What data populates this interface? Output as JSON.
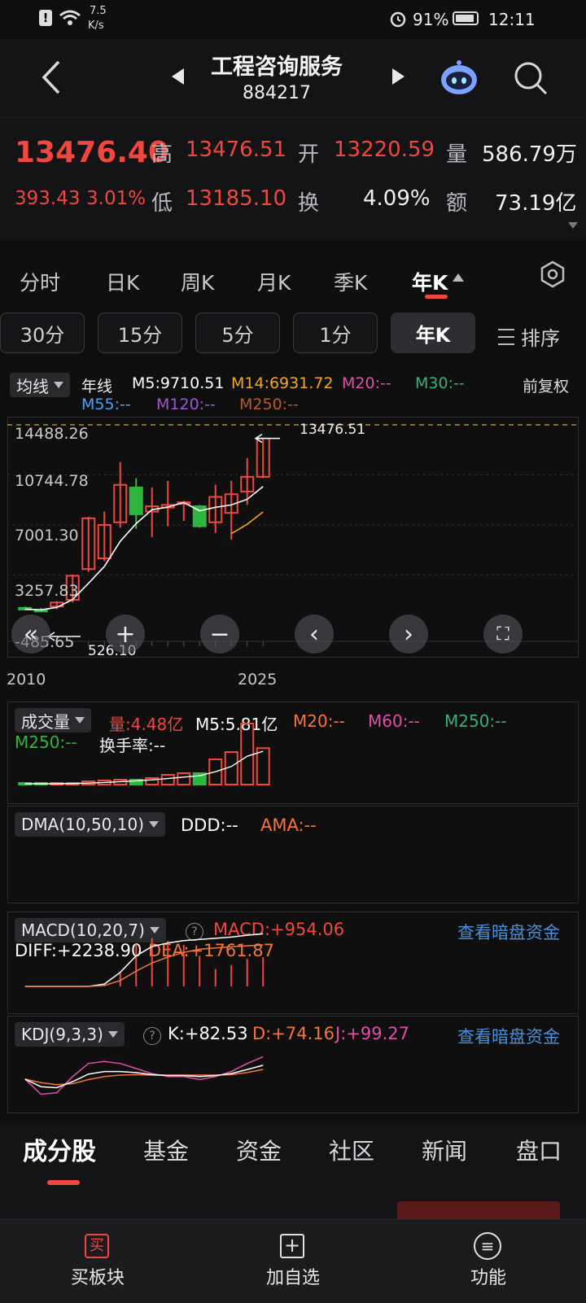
{
  "status": {
    "speed": "7.5",
    "speed_unit": "K/s",
    "battery": "91%",
    "time": "12:11"
  },
  "header": {
    "title": "工程咨询服务",
    "code": "884217"
  },
  "quote": {
    "price": "13476.40",
    "change": "393.43",
    "pct": "3.01%",
    "high_label": "高",
    "high": "13476.51",
    "open_label": "开",
    "open": "13220.59",
    "vol_label": "量",
    "vol": "586.79万",
    "low_label": "低",
    "low": "13185.10",
    "turn_label": "换",
    "turn": "4.09%",
    "amt_label": "额",
    "amt": "73.19亿"
  },
  "period_tabs": [
    "分时",
    "日K",
    "周K",
    "月K",
    "季K",
    "年K"
  ],
  "active_period": "年K",
  "segments": [
    "30分",
    "15分",
    "5分",
    "1分",
    "年K"
  ],
  "sort_label": "排序",
  "kline": {
    "ma_dropdown": "均线",
    "line_label": "年线",
    "m5": "M5:9710.51",
    "m14": "M14:6931.72",
    "m20": "M20:--",
    "m30": "M30:--",
    "m55": "M55:--",
    "m120": "M120:--",
    "m250": "M250:--",
    "adjust": "前复权",
    "y_labels": [
      "14488.26",
      "10744.78",
      "7001.30",
      "3257.83",
      "-485.65"
    ],
    "max_note": "13476.51",
    "min_note": "526.10",
    "x_labels": [
      "2010",
      "2025"
    ]
  },
  "volume": {
    "dropdown": "成交量",
    "vol": "量:4.48亿",
    "m5": "M5:5.81亿",
    "m20": "M20:--",
    "m60": "M60:--",
    "m250a": "M250:--",
    "m250b": "M250:--",
    "turnover": "换手率:--"
  },
  "dma": {
    "dropdown": "DMA(10,50,10)",
    "ddd": "DDD:--",
    "ama": "AMA:--"
  },
  "macd": {
    "dropdown": "MACD(10,20,7)",
    "macd": "MACD:+954.06",
    "diff": "DIFF:+2238.90",
    "dea": "DEA:+1761.87",
    "link": "查看暗盘资金"
  },
  "kdj": {
    "dropdown": "KDJ(9,3,3)",
    "k": "K:+82.53",
    "d": "D:+74.16",
    "j": "J:+99.27",
    "link": "查看暗盘资金"
  },
  "bottom_tabs": [
    "成分股",
    "基金",
    "资金",
    "社区",
    "新闻",
    "盘口"
  ],
  "bottom_nav": [
    {
      "label": "买板块",
      "icon": "buy-icon"
    },
    {
      "label": "加自选",
      "icon": "plus-square-icon"
    },
    {
      "label": "功能",
      "icon": "menu-circle-icon"
    }
  ],
  "colors": {
    "up": "#f0483e",
    "down": "#2fb640",
    "ma5": "#ffffff",
    "ma14": "#f5a623",
    "bg": "#0f0f10"
  },
  "chart_data": {
    "type": "candlestick",
    "candles": [
      {
        "o": 800,
        "h": 900,
        "l": 600,
        "c": 700
      },
      {
        "o": 650,
        "h": 780,
        "l": 500,
        "c": 600
      },
      {
        "o": 900,
        "h": 1300,
        "l": 700,
        "c": 1200
      },
      {
        "o": 1400,
        "h": 3300,
        "l": 1200,
        "c": 3200
      },
      {
        "o": 3700,
        "h": 7600,
        "l": 3500,
        "c": 7500
      },
      {
        "o": 4500,
        "h": 8000,
        "l": 4300,
        "c": 7000
      },
      {
        "o": 7200,
        "h": 11700,
        "l": 6800,
        "c": 10000
      },
      {
        "o": 9800,
        "h": 10500,
        "l": 6700,
        "c": 7800
      },
      {
        "o": 8000,
        "h": 9800,
        "l": 6100,
        "c": 8400
      },
      {
        "o": 8300,
        "h": 10300,
        "l": 6900,
        "c": 8500
      },
      {
        "o": 8600,
        "h": 8800,
        "l": 7300,
        "c": 8700
      },
      {
        "o": 8400,
        "h": 8500,
        "l": 6800,
        "c": 6900
      },
      {
        "o": 7200,
        "h": 10000,
        "l": 6400,
        "c": 9100
      },
      {
        "o": 7900,
        "h": 10300,
        "l": 5900,
        "c": 9300
      },
      {
        "o": 9500,
        "h": 12000,
        "l": 8500,
        "c": 10600
      },
      {
        "o": 10600,
        "h": 13476.51,
        "l": 10500,
        "c": 13476.4
      }
    ],
    "volumes": [
      0.1,
      0.1,
      0.1,
      0.2,
      0.4,
      0.5,
      0.6,
      0.6,
      0.8,
      1.2,
      1.4,
      1.4,
      3.1,
      4.0,
      7.5,
      4.48
    ],
    "macd_hist": [
      0,
      0,
      0,
      0,
      0,
      20,
      440,
      1380,
      1580,
      1490,
      1360,
      1000,
      570,
      700,
      900,
      954
    ],
    "ylim": [
      -485.65,
      14488.26
    ]
  }
}
